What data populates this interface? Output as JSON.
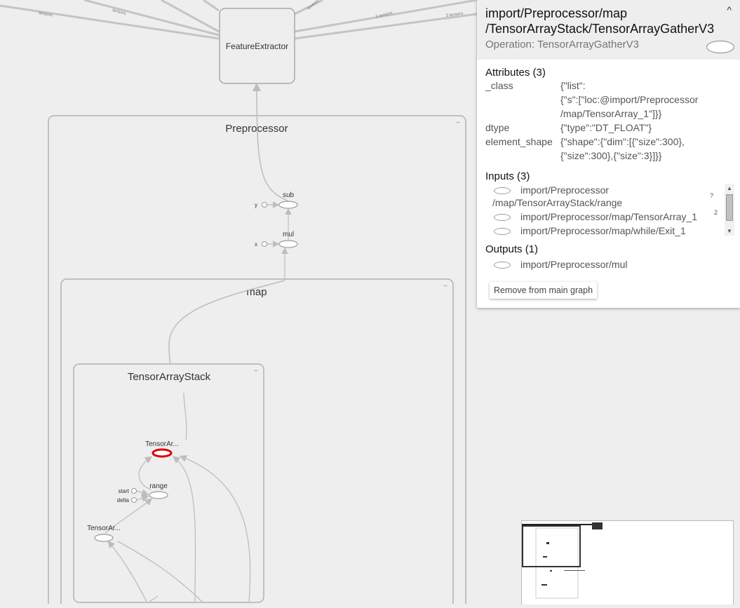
{
  "graph": {
    "nodes": {
      "feature_extractor": "FeatureExtractor",
      "preprocessor": "Preprocessor",
      "map": "map",
      "tensor_array_stack": "TensorArrayStack",
      "sub": "sub",
      "mul": "mul",
      "y": "y",
      "x": "x",
      "range": "range",
      "start": "start",
      "delta": "delta",
      "tensor_array_gather": "TensorAr...",
      "tensor_array_size": "TensorAr..."
    },
    "edge_labels": [
      "tensors",
      "tensors",
      "tensors",
      "3 tensors",
      "3 tensors"
    ],
    "expand_icon": "−"
  },
  "info": {
    "name_line1": "import/Preprocessor/map",
    "name_line2": "/TensorArrayStack/TensorArrayGatherV3",
    "operation": "Operation: TensorArrayGatherV3",
    "collapse_icon": "chevron-up-icon",
    "collapse_glyph": "^",
    "attributes_title": "Attributes (3)",
    "attributes": [
      {
        "key": "_class",
        "val1": "{\"list\":",
        "val2": "{\"s\":[\"loc:@import/Preprocessor",
        "val3": "/map/TensorArray_1\"]}}"
      },
      {
        "key": "dtype",
        "val1": "{\"type\":\"DT_FLOAT\"}"
      },
      {
        "key": "element_shape",
        "val1": "{\"shape\":{\"dim\":[{\"size\":300},",
        "val2": "{\"size\":300},{\"size\":3}]}}"
      }
    ],
    "inputs_title": "Inputs (3)",
    "inputs": [
      {
        "line1": "import/Preprocessor",
        "line2": "/map/TensorArrayStack/range",
        "extra": "?"
      },
      {
        "line1": "import/Preprocessor/map/TensorArray_1",
        "extra": "2"
      },
      {
        "line1": "import/Preprocessor/map/while/Exit_1"
      }
    ],
    "outputs_title": "Outputs (1)",
    "outputs": [
      {
        "line1": "import/Preprocessor/mul"
      }
    ],
    "remove_button": "Remove from main graph"
  },
  "colors": {
    "background": "#eeeeee",
    "edge": "#bdbdbd",
    "selected_node": "#e00000",
    "panel": "#ffffff"
  }
}
